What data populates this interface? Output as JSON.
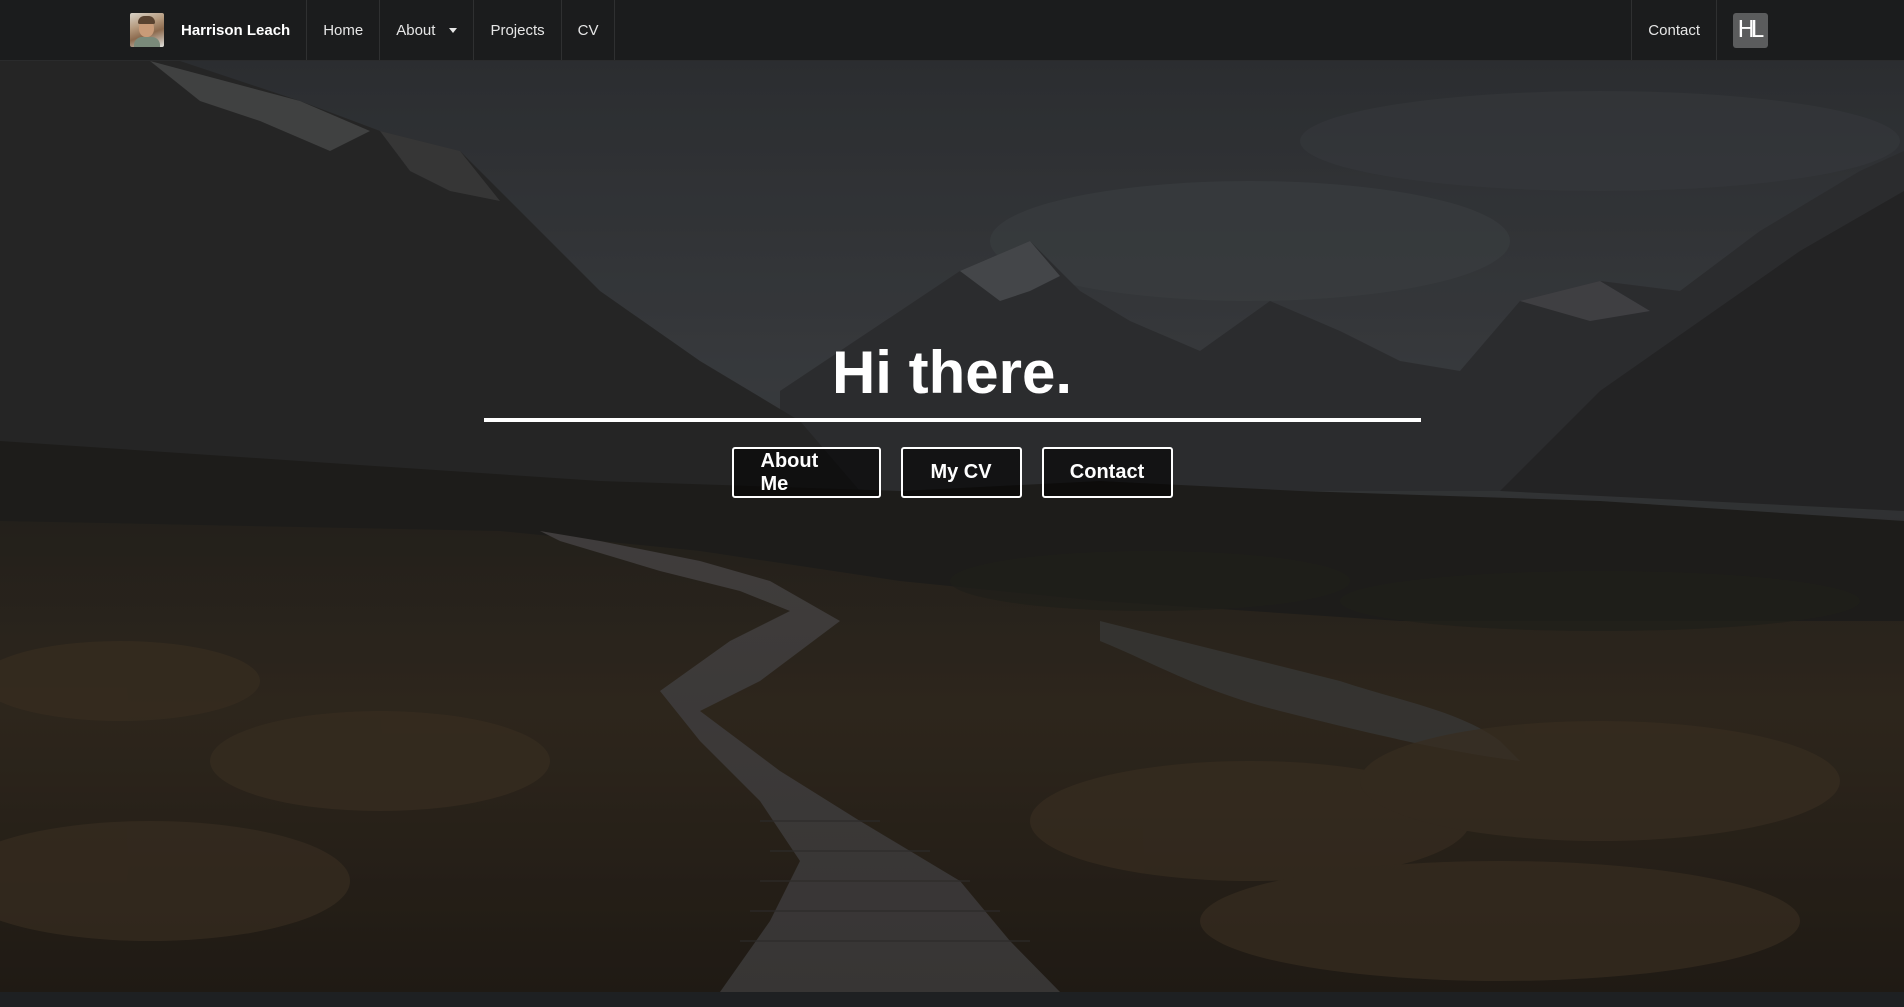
{
  "navbar": {
    "brand_name": "Harrison Leach",
    "items": [
      {
        "label": "Home"
      },
      {
        "label": "About",
        "has_dropdown": true
      },
      {
        "label": "Projects"
      },
      {
        "label": "CV"
      }
    ],
    "right_items": [
      {
        "label": "Contact"
      }
    ],
    "logo_text": "HL"
  },
  "hero": {
    "title": "Hi there.",
    "buttons": [
      {
        "label": "About Me"
      },
      {
        "label": "My CV"
      },
      {
        "label": "Contact"
      }
    ]
  },
  "colors": {
    "navbar_bg": "#1b1c1d",
    "nav_text": "#e6e6e6",
    "hero_text": "#ffffff",
    "logo_bg": "#5b5c5d"
  }
}
